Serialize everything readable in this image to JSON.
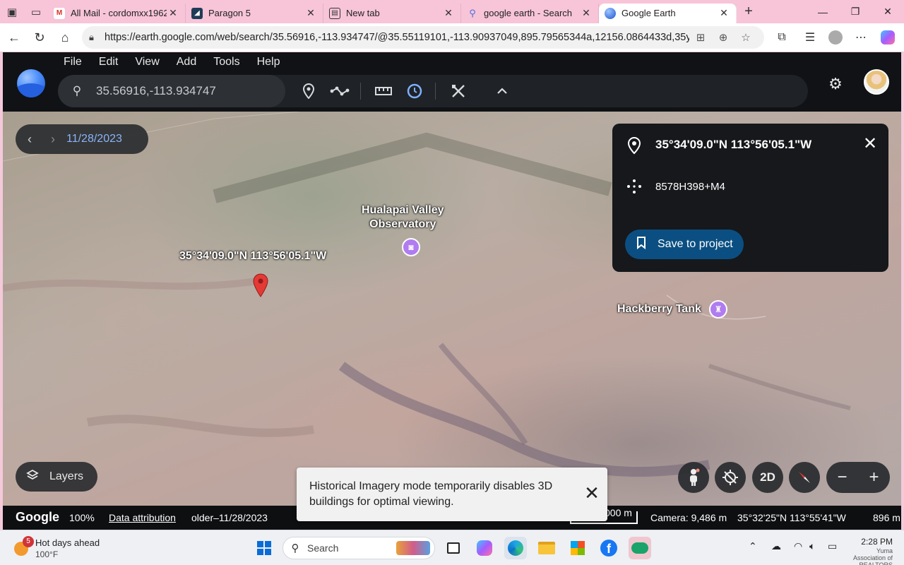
{
  "browser": {
    "tabs": [
      {
        "title": "All Mail - cordomxx1962",
        "favicon": "gmail-icon",
        "active": false
      },
      {
        "title": "Paragon 5",
        "favicon": "paragon-icon",
        "active": false
      },
      {
        "title": "New tab",
        "favicon": "newtab-icon",
        "active": false
      },
      {
        "title": "google earth - Search",
        "favicon": "search-icon",
        "active": false
      },
      {
        "title": "Google Earth",
        "favicon": "google-earth-icon",
        "active": true
      }
    ],
    "url": "https://earth.google.com/web/search/35.56916,-113.934747/@35.55119101,-113.90937049,895.79565344a,12156.0864433d,35y,44.2..."
  },
  "earth": {
    "menu": [
      "File",
      "Edit",
      "View",
      "Add",
      "Tools",
      "Help"
    ],
    "search": {
      "value": "35.56916,-113.934747"
    },
    "date_label": "11/28/2023",
    "info_panel": {
      "coordinates": "35°34'09.0\"N 113°56'05.1\"W",
      "plus_code": "8578H398+M4",
      "save_label": "Save to project"
    },
    "map_labels": {
      "marker_label": "35°34'09.0\"N 113°56'05.1\"W",
      "observatory_line1": "Hualapai Valley",
      "observatory_line2": "Observatory",
      "hackberry": "Hackberry Tank"
    },
    "layers_label": "Layers",
    "view_toggle": "2D",
    "toast": {
      "text": "Historical Imagery mode temporarily disables 3D buildings for optimal viewing."
    },
    "status": {
      "brand": "Google",
      "zoom": "100%",
      "attribution": "Data attribution",
      "imagery_range": "older–11/28/2023",
      "scale": "000 m",
      "camera": "Camera: 9,486 m",
      "cursor_coords": "35°32'25\"N 113°55'41\"W",
      "elevation": "896 m"
    }
  },
  "taskbar": {
    "weather_title": "Hot days ahead",
    "weather_temp": "100°F",
    "weather_badge": "5",
    "search_label": "Search",
    "time": "2:28 PM",
    "watermark": "Yuma Association of REALTORS"
  },
  "colors": {
    "accent_blue": "#8ab4f8",
    "save_button": "#0b4f82",
    "poi_purple": "#b07cf0",
    "marker_red": "#e53935"
  }
}
